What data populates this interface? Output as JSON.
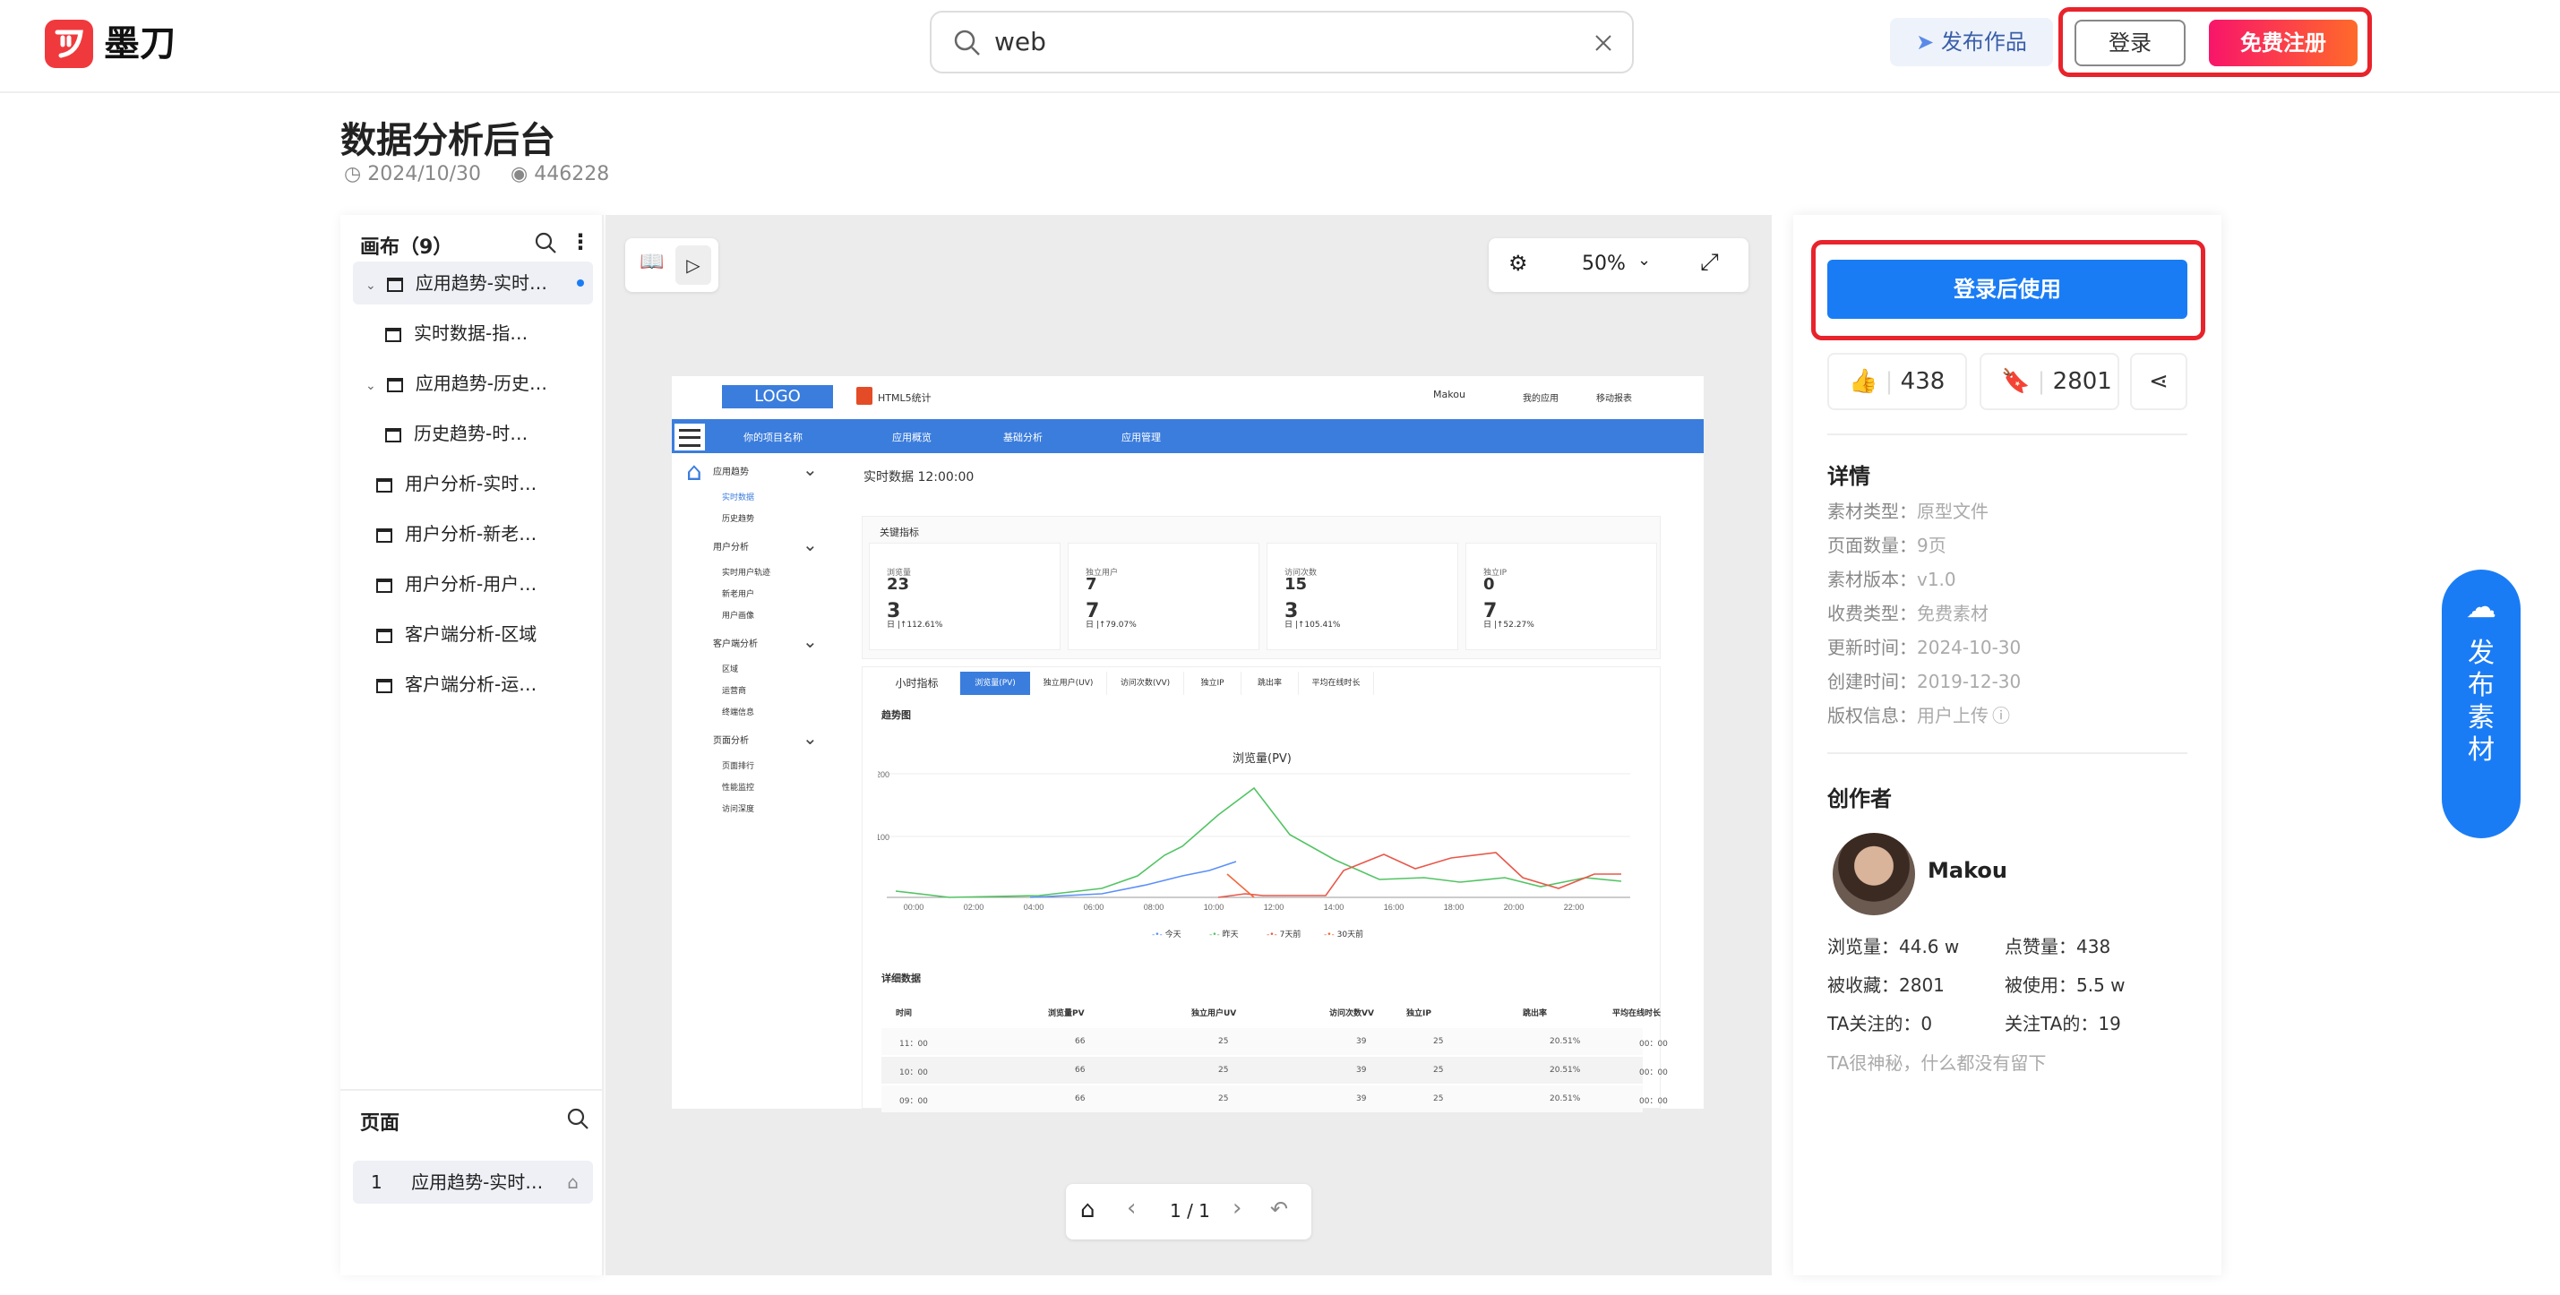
{
  "header": {
    "logo_text": "墨刀",
    "search_value": "web",
    "publish_label": "发布作品",
    "login_label": "登录",
    "register_label": "免费注册"
  },
  "page": {
    "title": "数据分析后台",
    "date": "2024/10/30",
    "views": "446228"
  },
  "left_panel": {
    "canvas_title": "画布（9）",
    "tree": [
      {
        "label": "应用趋势-实时…",
        "level": 0,
        "selected": true
      },
      {
        "label": "实时数据-指…",
        "level": 1
      },
      {
        "label": "应用趋势-历史…",
        "level": 0
      },
      {
        "label": "历史趋势-时…",
        "level": 1
      },
      {
        "label": "用户分析-实时…",
        "level": 0
      },
      {
        "label": "用户分析-新老…",
        "level": 0
      },
      {
        "label": "用户分析-用户…",
        "level": 0
      },
      {
        "label": "客户端分析-区域",
        "level": 0
      },
      {
        "label": "客户端分析-运…",
        "level": 0
      }
    ],
    "pages_title": "页面",
    "page_item_num": "1",
    "page_item_label": "应用趋势-实时…"
  },
  "toolbar": {
    "zoom": "50%"
  },
  "pager": {
    "label": "1 / 1"
  },
  "mock": {
    "logo": "LOGO",
    "brand": "HTML5统计",
    "user": "Makou",
    "my_apps": "我的应用",
    "mobile": "移动报表",
    "nav": [
      "你的项目名称",
      "应用概览",
      "基础分析",
      "应用管理"
    ],
    "side": [
      "应用趋势",
      "实时数据",
      "历史趋势",
      "用户分析",
      "实时用户轨迹",
      "新老用户",
      "用户画像",
      "客户端分析",
      "区域",
      "运营商",
      "终端信息",
      "页面分析",
      "页面排行",
      "性能监控",
      "访问深度"
    ],
    "realtime": "实时数据 12:00:00",
    "kpi_title": "关键指标",
    "kpis": [
      {
        "name": "浏览量",
        "a": "23",
        "b": "3",
        "pct": "日 |↑112.61%"
      },
      {
        "name": "独立用户",
        "a": "7",
        "b": "7",
        "pct": "日 |↑79.07%"
      },
      {
        "name": "访问次数",
        "a": "15",
        "b": "3",
        "pct": "日 |↑105.41%"
      },
      {
        "name": "独立IP",
        "a": "0",
        "b": "7",
        "pct": "日 |↑52.27%"
      }
    ],
    "tabs": [
      "小时指标",
      "浏览量(PV)",
      "独立用户(UV)",
      "访问次数(VV)",
      "独立IP",
      "跳出率",
      "平均在线时长"
    ],
    "trend": "趋势图",
    "chart_title": "浏览量(PV)",
    "xticks": [
      "00:00",
      "02:00",
      "04:00",
      "06:00",
      "08:00",
      "10:00",
      "12:00",
      "14:00",
      "16:00",
      "18:00",
      "20:00",
      "22:00"
    ],
    "yticks": [
      "200",
      "100"
    ],
    "legend": [
      "今天",
      "昨天",
      "7天前",
      "30天前"
    ],
    "detail": "详细数据",
    "cols": [
      "时间",
      "浏览量PV",
      "独立用户UV",
      "访问次数VV",
      "独立IP",
      "跳出率",
      "平均在线时长"
    ],
    "rows": [
      [
        "11：00",
        "66",
        "25",
        "39",
        "25",
        "20.51%",
        "00：00"
      ],
      [
        "10：00",
        "66",
        "25",
        "39",
        "25",
        "20.51%",
        "00：00"
      ],
      [
        "09：00",
        "66",
        "25",
        "39",
        "25",
        "20.51%",
        "00：00"
      ]
    ]
  },
  "right_panel": {
    "use_label": "登录后使用",
    "likes": "438",
    "favorites": "2801",
    "details_title": "详情",
    "details": [
      {
        "k": "素材类型：",
        "v": "原型文件"
      },
      {
        "k": "页面数量：",
        "v": "9页"
      },
      {
        "k": "素材版本：",
        "v": "v1.0"
      },
      {
        "k": "收费类型：",
        "v": "免费素材"
      },
      {
        "k": "更新时间：",
        "v": "2024-10-30"
      },
      {
        "k": "创建时间：",
        "v": "2019-12-30"
      },
      {
        "k": "版权信息：",
        "v": "用户上传"
      }
    ],
    "creator_title": "创作者",
    "creator_name": "Makou",
    "views": "浏览量：44.6 w",
    "likes_stat": "点赞量：438",
    "fav_stat": "被收藏：2801",
    "used_stat": "被使用：5.5 w",
    "following": "TA关注的：0",
    "followers": "关注TA的：19",
    "bio": "TA很神秘，什么都没有留下"
  },
  "float_btn": {
    "chars": [
      "发",
      "布",
      "素",
      "材"
    ]
  },
  "colors": {
    "brand_red": "#f0393d",
    "primary": "#1a7cf5",
    "accent_pink": "#f8156a"
  }
}
